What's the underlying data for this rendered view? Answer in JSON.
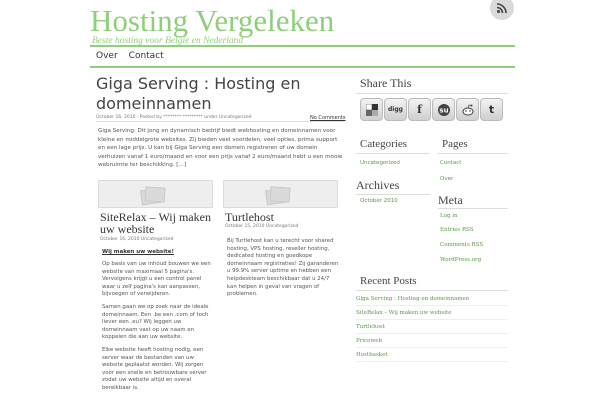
{
  "site": {
    "title": "Hosting Vergeleken",
    "description": "Beste hosting voor Belgie en Nederland"
  },
  "nav": {
    "items": [
      "Over",
      "Contact"
    ]
  },
  "post": {
    "title": "Giga Serving : Hosting en domeinnamen",
    "meta": "October 16, 2010 · Posted by ******** ********* under Uncategorized",
    "more": "No Comments",
    "body": "Giga Serving: Dit jong en dynamisch bedrijf  biedt webhosting en domeinnamen voor kleine en middelgrote websites. Zij bieden veel voordelen, veel opties, prima support en een lage prijs. U kan bij Giga Serving een domein registreren of uw domein verhuizen vanaf 1 euro/maand en voor een prijs vanaf 2 euro/maand hebt u een mooie webruimte ter beschikking. [...]"
  },
  "cards": [
    {
      "title": "SiteRelax – Wij maken uw website",
      "meta": "October 16, 2010     Uncategorized",
      "link": "Wij maken uw website!",
      "paragraphs": [
        "Op basis van uw inhoud bouwen we een website van maximaal 5 pagina's. Vervolgens krijgt u een control panel waar u zelf pagina's kan aanpassen, bijvoegen of verwijderen.",
        "Samen gaan we op zoek naar de ideale domeinnaam. Een .be een .com of toch liever een .eu? Wij leggen uw domeinnaam vast op uw naam en koppelen die aan uw website.",
        "Elke website heeft hosting nodig, een server waar de bestanden van uw website geplaatst worden. Wij zorgen voor een snelle en betrouwbare server zodat uw website altijd en overal bereikbaar is."
      ]
    },
    {
      "title": "Turtlehost",
      "meta": "October 15, 2010     Uncategorized",
      "paragraphs": [
        "Bij Turtlehost kan u terecht voor shared hosting, VPS hosting, reseller hosting, dedicated hosting en goedkope domeinnaam registraties! Zij garanderen u 99.9% server uptime en hebben een helpdeskteam beschikbaar dat u 24/7 kan helpen in geval van vragen of problemen."
      ]
    }
  ],
  "sidebar": {
    "share_title": "Share This",
    "social": [
      "delicious",
      "digg",
      "facebook",
      "stumbleupon",
      "reddit",
      "twitter"
    ],
    "social_icons": [
      "delicious-icon",
      "digg-icon",
      "facebook-icon",
      "stumbleupon-icon",
      "reddit-icon",
      "twitter-icon"
    ],
    "categories_title": "Categories",
    "categories": [
      "Uncategorized"
    ],
    "archives_title": "Archives",
    "archives": [
      "October 2010"
    ],
    "pages_title": "Pages",
    "pages": [
      "Contact",
      "Over"
    ],
    "meta_title": "Meta",
    "meta": [
      "Log in",
      "Entries RSS",
      "Comments RSS",
      "WordPress.org"
    ],
    "recent_title": "Recent Posts",
    "recent": [
      "Giga Serving : Hosting en domeinnamen",
      "SiteRelax – Wij maken uw website",
      "Turtlehost",
      "Pricoweb",
      "Hostbasket"
    ]
  },
  "colors": {
    "accent": "#8fcf7a",
    "link": "#559944"
  }
}
